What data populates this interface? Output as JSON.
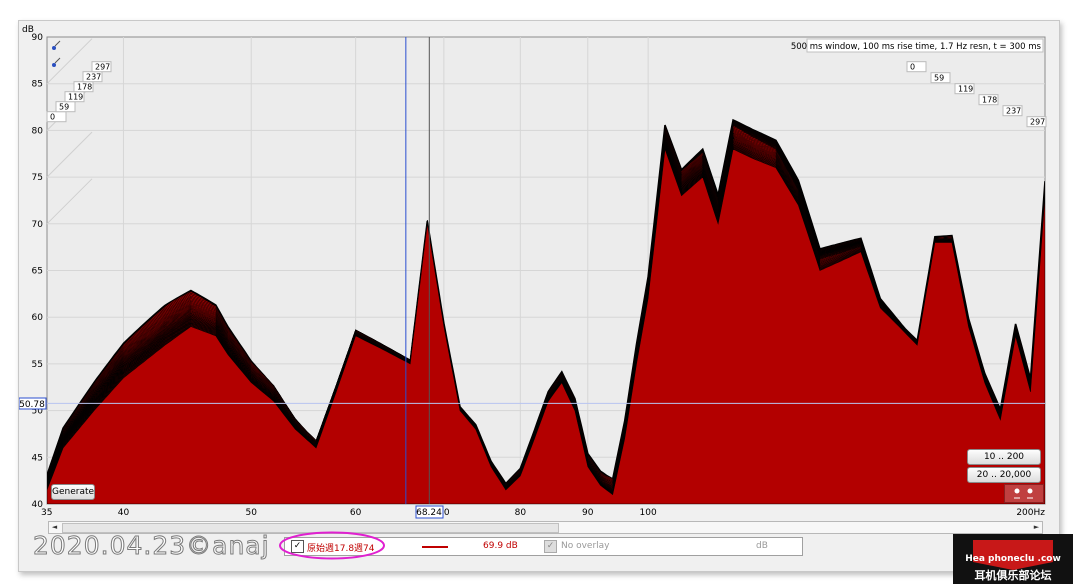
{
  "chart_data": {
    "type": "area",
    "title": "500 ms window, 100 ms rise time,  1.7 Hz resn, t = 300 ms",
    "xlabel": "Hz",
    "ylabel": "dB",
    "x_scale": "log",
    "xlim": [
      35,
      200
    ],
    "ylim": [
      40,
      90
    ],
    "x_ticks": [
      "35",
      "40",
      "50",
      "60",
      "70",
      "80",
      "90",
      "100",
      "200Hz"
    ],
    "y_ticks": [
      "40",
      "45",
      "50",
      "55",
      "60",
      "65",
      "70",
      "75",
      "80",
      "85",
      "90"
    ],
    "y_axis_title": "dB",
    "time_slice_labels": [
      "0",
      "59",
      "119",
      "178",
      "237",
      "297"
    ],
    "cursor": {
      "x": "68.24",
      "y": "50.78"
    },
    "fill_color": "#b30000",
    "line_color": "#000000",
    "series": [
      {
        "x": [
          35,
          36,
          38,
          40,
          43,
          45,
          47,
          48,
          50,
          52,
          54,
          56,
          58,
          60,
          62,
          64,
          66,
          68,
          70,
          72,
          74,
          76,
          78,
          80,
          82,
          84,
          86,
          88,
          90,
          92,
          94,
          96,
          98,
          100,
          103,
          106,
          110,
          113,
          116,
          120,
          125,
          130,
          135,
          140,
          145,
          150,
          155,
          160,
          165,
          170,
          175,
          180,
          185,
          190,
          195,
          200
        ],
        "values": [
          41.5,
          46,
          50,
          53.5,
          57,
          59,
          58,
          56,
          53,
          51,
          48,
          46,
          52,
          58,
          57,
          56,
          55,
          70,
          59,
          50,
          48,
          44,
          41.5,
          43,
          47,
          51,
          53,
          50,
          44,
          42,
          41,
          47,
          55,
          62,
          78,
          73,
          75,
          70,
          78,
          77,
          76,
          72,
          65,
          66,
          67,
          61,
          59,
          57,
          68,
          68,
          59,
          53,
          49,
          58,
          52,
          73
        ]
      }
    ]
  },
  "plot": {
    "title": "500 ms window, 100 ms rise time,  1.7 Hz resn, t = 300 ms",
    "y_axis_title": "dB",
    "cursor_x_label": "68.24",
    "cursor_y_label": "50.78",
    "x_tick_labels": [
      "35",
      "40",
      "50",
      "60",
      "70",
      "80",
      "90",
      "100",
      "200Hz"
    ],
    "y_tick_labels": [
      "40",
      "45",
      "50",
      "55",
      "60",
      "65",
      "70",
      "75",
      "80",
      "85",
      "90"
    ],
    "time_labels": [
      "0",
      "59",
      "119",
      "178",
      "237",
      "297"
    ]
  },
  "controls": {
    "generate": "Generate",
    "range_1": "10 .. 200",
    "range_2": "20 .. 20,000",
    "scroll_left": "◄",
    "scroll_right": "►"
  },
  "legend": {
    "checkbox": "✓",
    "measurement_name": "原始週17.8週74",
    "level": "69.9 dB",
    "overlay_label": "No overlay",
    "overlay_unit": "dB"
  },
  "watermark": "2020.04.23©anaj",
  "logo": {
    "line1": "Hea   phoneclu    .cow",
    "line2": "耳机俱乐部论坛"
  },
  "colors": {
    "fill": "#b30000",
    "legend_line": "#c00000",
    "highlight_ellipse": "#e020d0",
    "range_button_accent": "#c04040"
  }
}
